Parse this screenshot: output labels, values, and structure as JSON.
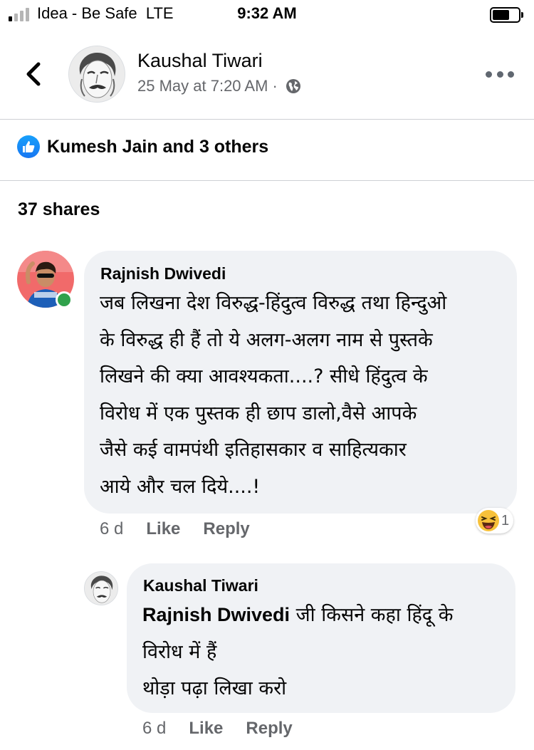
{
  "status_bar": {
    "carrier": "Idea - Be Safe  LTE",
    "time": "9:32 AM",
    "signal_bars_filled": 1,
    "signal_bars_total": 4,
    "battery_level": 0.55
  },
  "post": {
    "author": "Kaushal Tiwari",
    "timestamp": "25 May at 7:20 AM",
    "separator": "·",
    "privacy_icon": "globe-icon"
  },
  "reactions": {
    "icon": "like-icon",
    "text": "Kumesh Jain and 3 others"
  },
  "shares": "37 shares",
  "comments": [
    {
      "author": "Rajnish Dwivedi",
      "online": true,
      "lines": [
        "जब लिखना देश विरुद्ध-हिंदुत्व विरुद्ध तथा हिन्दुओ",
        "के विरुद्ध ही हैं तो ये अलग-अलग नाम से पुस्तके",
        "लिखने की क्या आवश्यकता....? सीधे हिंदुत्व के",
        "विरोध में एक पुस्तक ही छाप डालो,वैसे आपके",
        "जैसे कई वामपंथी इतिहासकार व साहित्यकार",
        "आये और चल दिये....!"
      ],
      "time": "6 d",
      "like_label": "Like",
      "reply_label": "Reply",
      "reaction": {
        "icon": "haha-emoji-icon",
        "count": "1"
      }
    },
    {
      "author": "Kaushal Tiwari",
      "mention": "Rajnish Dwivedi",
      "line1_rest": " जी किसने कहा हिंदू के",
      "lines": [
        "विरोध में हैं",
        "थोड़ा पढ़ा लिखा करो"
      ],
      "time": "6 d",
      "like_label": "Like",
      "reply_label": "Reply"
    }
  ],
  "colors": {
    "facebook_blue": "#1877f2",
    "bubble_bg": "#f0f2f5",
    "secondary_text": "#65676b",
    "online_green": "#31a24c"
  }
}
